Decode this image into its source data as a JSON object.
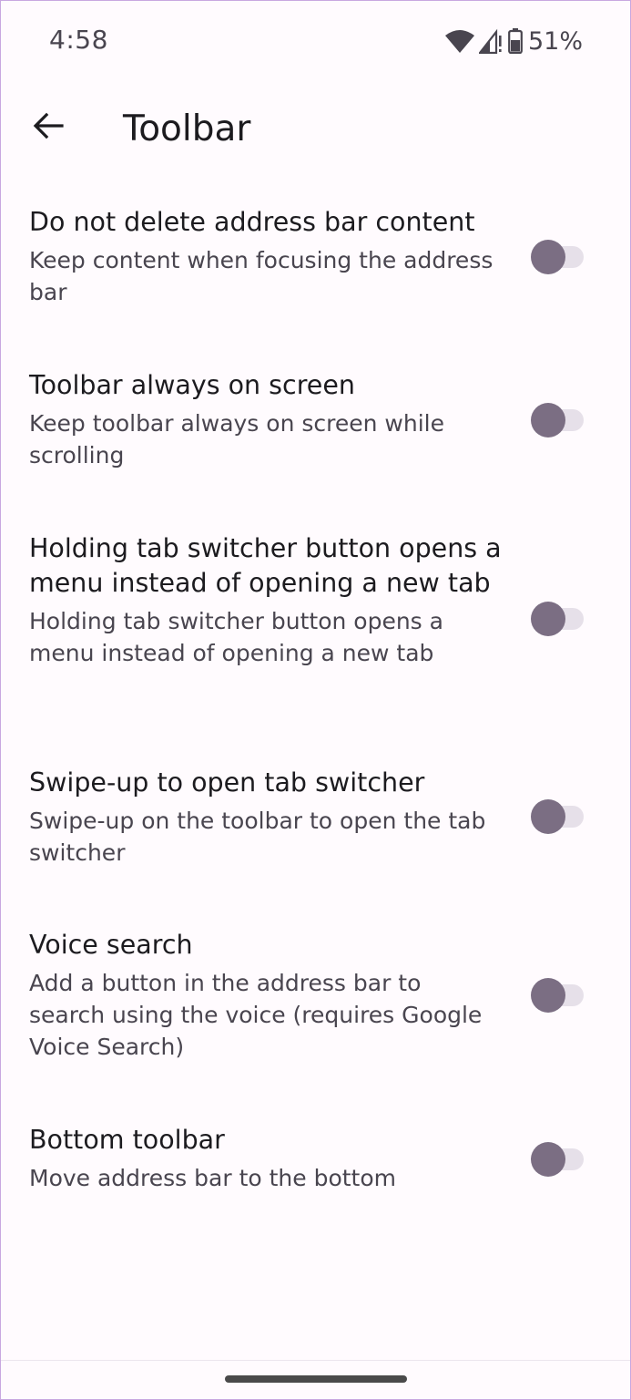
{
  "status_bar": {
    "time": "4:58",
    "battery_percent": "51%",
    "icons": [
      "wifi-icon",
      "cellular-no-signal-icon",
      "battery-icon"
    ]
  },
  "app_bar": {
    "back_icon": "arrow-back-icon",
    "title": "Toolbar"
  },
  "settings": [
    {
      "title": "Do not delete address bar content",
      "summary": "Keep content when focusing the address bar",
      "enabled": false
    },
    {
      "title": "Toolbar always on screen",
      "summary": "Keep toolbar always on screen while scrolling",
      "enabled": false
    },
    {
      "title": "Holding tab switcher button opens a menu instead of opening a new tab",
      "summary": "Holding tab switcher button opens a menu instead of opening a new tab",
      "enabled": false
    },
    {
      "title": "Swipe-up to open tab switcher",
      "summary": "Swipe-up on the toolbar to open the tab switcher",
      "enabled": false
    },
    {
      "title": "Voice search",
      "summary": "Add a button in the address bar to search using the voice (requires Google Voice Search)",
      "enabled": false
    },
    {
      "title": "Bottom toolbar",
      "summary": "Move address bar to the bottom",
      "enabled": false
    }
  ],
  "colors": {
    "background": "#fffbfe",
    "title_text": "#1c1b1f",
    "summary_text": "#49454f",
    "toggle_thumb_off": "#7b6e83",
    "toggle_track_off": "#e6e0e9"
  }
}
